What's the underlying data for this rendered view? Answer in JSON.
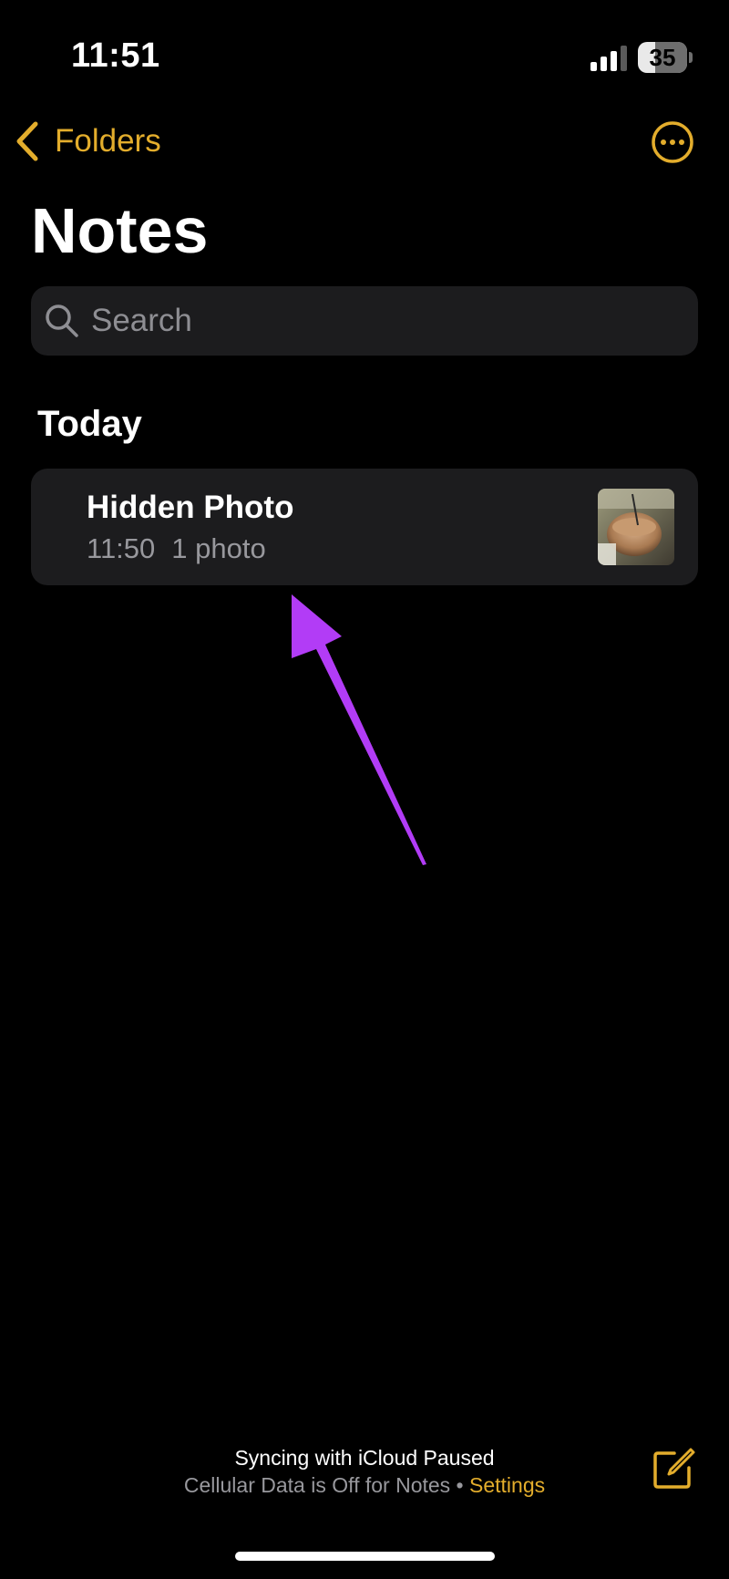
{
  "status_bar": {
    "time": "11:51",
    "battery_level": "35",
    "battery_fraction": 0.35
  },
  "nav": {
    "back_label": "Folders",
    "back_icon": "chevron-left-icon",
    "more_icon": "ellipsis-circle-icon"
  },
  "page": {
    "title": "Notes"
  },
  "search": {
    "placeholder": "Search",
    "value": ""
  },
  "sections": [
    {
      "header": "Today",
      "notes": [
        {
          "title": "Hidden Photo",
          "time": "11:50",
          "preview": "1 photo",
          "thumbnail": "photo-thumbnail"
        }
      ]
    }
  ],
  "footer": {
    "sync_title": "Syncing with iCloud Paused",
    "sync_subtitle": "Cellular Data is Off for Notes • ",
    "settings_link": "Settings",
    "compose_icon": "compose-note-icon"
  },
  "colors": {
    "accent": "#e3ad2c",
    "background": "#000000",
    "card": "#1c1c1e",
    "secondary_text": "#98989d",
    "annotation_arrow": "#b23cf6"
  }
}
